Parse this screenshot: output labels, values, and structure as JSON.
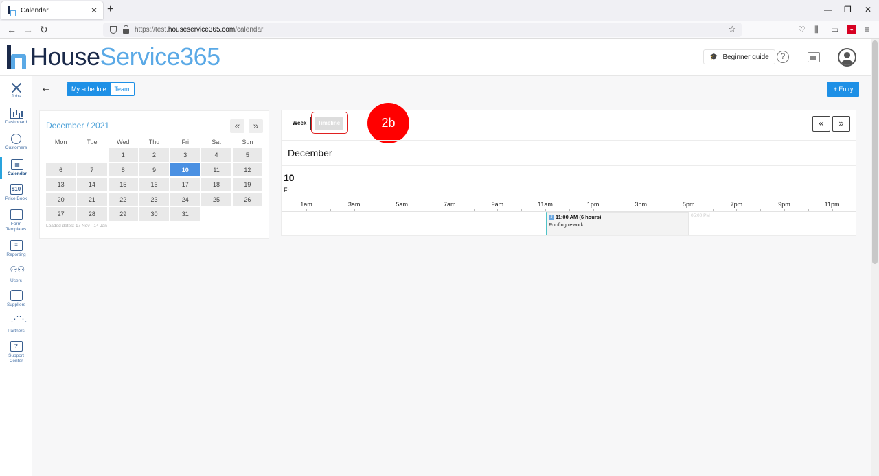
{
  "browser": {
    "tab_title": "Calendar",
    "tab_close": "✕",
    "new_tab": "+",
    "url_prefix": "https://test.",
    "url_domain": "houseservice365.com",
    "url_path": "/calendar",
    "win_min": "—",
    "win_restore": "❐",
    "win_close": "✕"
  },
  "header": {
    "logo_part1": "House",
    "logo_part2": "Service365",
    "beginner_guide": "Beginner guide",
    "help": "?"
  },
  "sidebar": {
    "items": [
      {
        "label": "Jobs"
      },
      {
        "label": "Dashboard"
      },
      {
        "label": "Customers"
      },
      {
        "label": "Calendar"
      },
      {
        "label": "Price Book",
        "glyph": "$10"
      },
      {
        "label": "Form Templates"
      },
      {
        "label": "Reporting"
      },
      {
        "label": "Users"
      },
      {
        "label": "Suppliers"
      },
      {
        "label": "Partners"
      },
      {
        "label": "Support Center",
        "glyph": "?"
      }
    ]
  },
  "toolbar": {
    "back": "←",
    "my_schedule": "My schedule",
    "team": "Team",
    "entry": "+  Entry"
  },
  "mini_calendar": {
    "title": "December / 2021",
    "prev": "«",
    "next": "»",
    "weekdays": [
      "Mon",
      "Tue",
      "Wed",
      "Thu",
      "Fri",
      "Sat",
      "Sun"
    ],
    "weeks": [
      [
        "",
        "",
        "1",
        "2",
        "3",
        "4",
        "5"
      ],
      [
        "6",
        "7",
        "8",
        "9",
        "10",
        "11",
        "12"
      ],
      [
        "13",
        "14",
        "15",
        "16",
        "17",
        "18",
        "19"
      ],
      [
        "20",
        "21",
        "22",
        "23",
        "24",
        "25",
        "26"
      ],
      [
        "27",
        "28",
        "29",
        "30",
        "31",
        "",
        ""
      ]
    ],
    "selected": "10",
    "loaded_dates": "Loaded dates: 17 Nov - 14 Jan"
  },
  "scheduler": {
    "view_week": "Week",
    "view_timeline": "Timeline",
    "step_badge": "2b",
    "prev": "«",
    "next": "»",
    "month": "December",
    "day_number": "10",
    "day_name": "Fri",
    "hours": [
      "1am",
      "3am",
      "5am",
      "7am",
      "9am",
      "11am",
      "1pm",
      "3pm",
      "5pm",
      "7pm",
      "9pm",
      "11pm"
    ],
    "event": {
      "icon": "J",
      "time": "11:00 AM (6 hours)",
      "title": "Roofing rework",
      "end_marker": "05:00 PM"
    }
  }
}
